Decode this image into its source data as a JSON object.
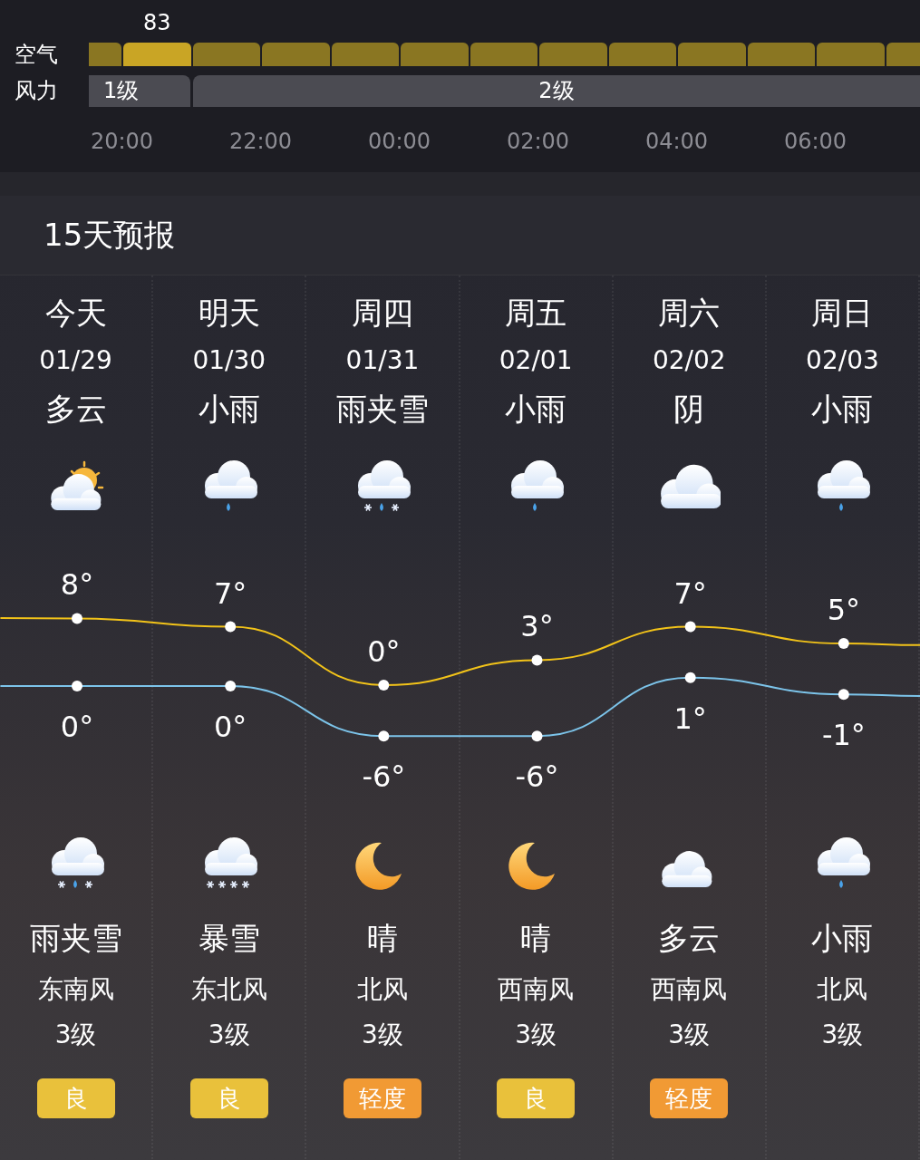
{
  "air": {
    "label": "空气",
    "segments": [
      {
        "selected": false
      },
      {
        "selected": true,
        "value": "83"
      },
      {
        "selected": false
      },
      {
        "selected": false
      },
      {
        "selected": false
      },
      {
        "selected": false
      },
      {
        "selected": false
      },
      {
        "selected": false
      },
      {
        "selected": false
      },
      {
        "selected": false
      },
      {
        "selected": false
      },
      {
        "selected": false
      },
      {
        "selected": false
      }
    ]
  },
  "wind": {
    "label": "风力",
    "segments": [
      {
        "text": "1级"
      },
      {
        "text": "2级"
      }
    ]
  },
  "times": [
    "20:00",
    "22:00",
    "00:00",
    "02:00",
    "04:00",
    "06:00"
  ],
  "forecast_title": "15天预报",
  "days": [
    {
      "day": "今天",
      "date": "01/29",
      "day_condition": "多云",
      "day_icon": {
        "kind": "partly_cloudy_day"
      },
      "night_icon": {
        "kind": "sleet"
      },
      "night_condition": "雨夹雪",
      "wind_direction": "东南风",
      "wind_level": "3级",
      "aqi": {
        "text": "良",
        "color": "#e9c13b"
      }
    },
    {
      "day": "明天",
      "date": "01/30",
      "day_condition": "小雨",
      "day_icon": {
        "kind": "rain"
      },
      "night_icon": {
        "kind": "snow"
      },
      "night_condition": "暴雪",
      "wind_direction": "东北风",
      "wind_level": "3级",
      "aqi": {
        "text": "良",
        "color": "#e9c13b"
      }
    },
    {
      "day": "周四",
      "date": "01/31",
      "day_condition": "雨夹雪",
      "day_icon": {
        "kind": "sleet"
      },
      "night_icon": {
        "kind": "moon"
      },
      "night_condition": "晴",
      "wind_direction": "北风",
      "wind_level": "3级",
      "aqi": {
        "text": "轻度",
        "color": "#f19a34"
      }
    },
    {
      "day": "周五",
      "date": "02/01",
      "day_condition": "小雨",
      "day_icon": {
        "kind": "rain"
      },
      "night_icon": {
        "kind": "moon"
      },
      "night_condition": "晴",
      "wind_direction": "西南风",
      "wind_level": "3级",
      "aqi": {
        "text": "良",
        "color": "#e9c13b"
      }
    },
    {
      "day": "周六",
      "date": "02/02",
      "day_condition": "阴",
      "day_icon": {
        "kind": "cloudy"
      },
      "night_icon": {
        "kind": "partly_cloudy_night"
      },
      "night_condition": "多云",
      "wind_direction": "西南风",
      "wind_level": "3级",
      "aqi": {
        "text": "轻度",
        "color": "#f19a34"
      }
    },
    {
      "day": "周日",
      "date": "02/03",
      "day_condition": "小雨",
      "day_icon": {
        "kind": "rain"
      },
      "night_icon": {
        "kind": "rain"
      },
      "night_condition": "小雨",
      "wind_direction": "北风",
      "wind_level": "3级"
    }
  ],
  "chart_data": {
    "type": "line",
    "categories": [
      null,
      null,
      null,
      null,
      null,
      null
    ],
    "series": [
      {
        "color": "#f2c319",
        "marker": "circle",
        "values": [
          8,
          7,
          0,
          3,
          7,
          5
        ],
        "value_labels": [
          "8°",
          "7°",
          "0°",
          "3°",
          "7°",
          "5°"
        ]
      },
      {
        "color": "#7cc4ea",
        "marker": "circle",
        "values": [
          0,
          0,
          -6,
          -6,
          1,
          -1
        ],
        "value_labels": [
          "0°",
          "0°",
          "-6°",
          "-6°",
          "1°",
          "-1°"
        ]
      }
    ]
  }
}
